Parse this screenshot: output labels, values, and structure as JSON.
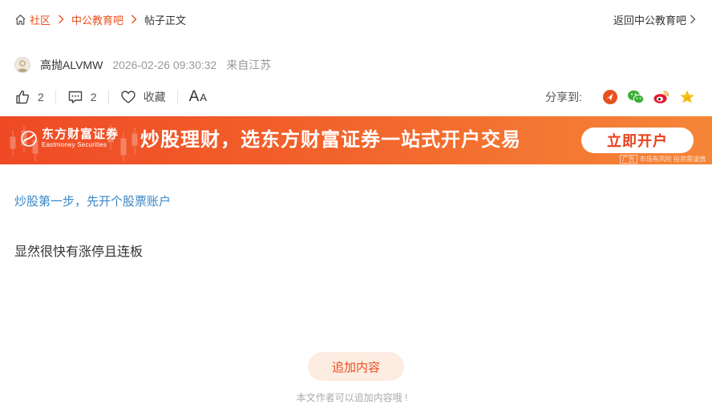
{
  "breadcrumb": {
    "items": [
      "社区",
      "中公教育吧"
    ],
    "current": "帖子正文"
  },
  "back_link": "返回中公教育吧",
  "author": {
    "name": "高抛ALVMW",
    "time": "2026-02-26 09:30:32",
    "location": "来自江苏"
  },
  "actions": {
    "likes": "2",
    "comments": "2",
    "favorite_label": "收藏",
    "font_big": "A",
    "font_small": "A"
  },
  "share": {
    "label": "分享到:",
    "targets": [
      "toutiao",
      "wechat",
      "weibo",
      "qzone"
    ]
  },
  "ad": {
    "logo_cn": "东方财富证券",
    "logo_en": "Eastmoney Securities",
    "slogan": "炒股理财，选东方财富证券一站式开户交易",
    "cta": "立即开户",
    "tag_box": "广告",
    "tag_text": "市场有风险 投资需谨慎"
  },
  "promo_link": "炒股第一步，先开个股票账户",
  "post_body": "显然很快有涨停且连板",
  "append": {
    "button": "追加内容",
    "hint": "本文作者可以追加内容哦 !"
  },
  "colors": {
    "accent": "#e8501f",
    "link_blue": "#3a86c8",
    "banner_start": "#ef4a25",
    "banner_end": "#f58638"
  }
}
